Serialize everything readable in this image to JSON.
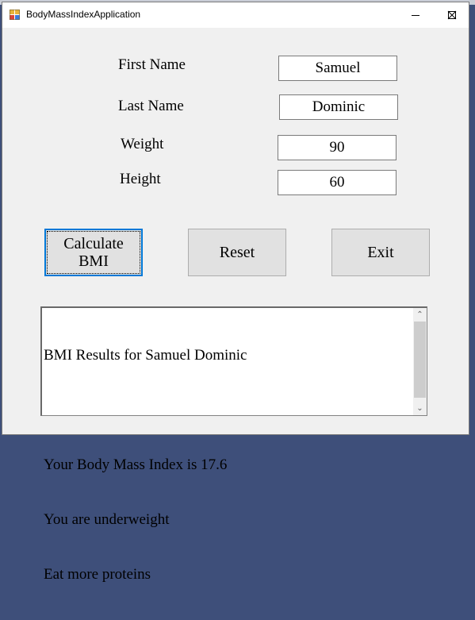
{
  "window": {
    "title": "BodyMassIndexApplication",
    "icon": "winforms-app-icon",
    "controls": {
      "minimize": "minimize-icon",
      "maximize": "maximize-icon",
      "close": "close-icon"
    }
  },
  "form": {
    "first_name": {
      "label": "First Name",
      "value": "Samuel"
    },
    "last_name": {
      "label": "Last Name",
      "value": "Dominic"
    },
    "weight": {
      "label": "Weight",
      "value": "90"
    },
    "height": {
      "label": "Height",
      "value": "60"
    }
  },
  "buttons": {
    "calculate": "Calculate BMI",
    "reset": "Reset",
    "exit": "Exit"
  },
  "results": {
    "lines": [
      "BMI Results for Samuel Dominic",
      "",
      "Your Body Mass Index is 17.6",
      "You are underweight",
      "Eat more proteins"
    ]
  },
  "colors": {
    "focus_border": "#0078d7",
    "window_bg": "#f0f0f0",
    "button_bg": "#e1e1e1"
  }
}
